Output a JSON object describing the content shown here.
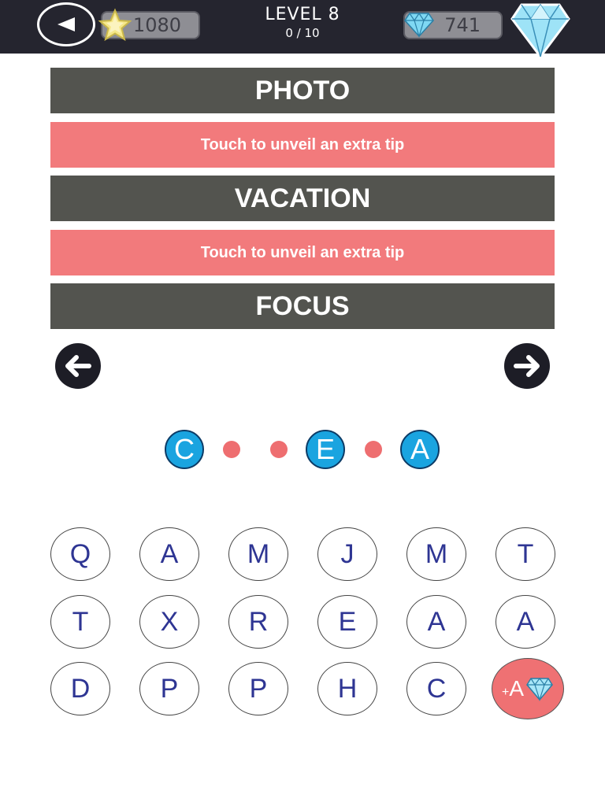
{
  "header": {
    "back_icon": "back-triangle-icon",
    "stars": "1080",
    "level_label": "LEVEL  8",
    "progress": "0 / 10",
    "gems": "741"
  },
  "clues": [
    {
      "type": "word",
      "text": "PHOTO"
    },
    {
      "type": "tip",
      "text": "Touch to unveil an extra tip"
    },
    {
      "type": "word",
      "text": "VACATION"
    },
    {
      "type": "tip",
      "text": "Touch to unveil an extra tip"
    },
    {
      "type": "word",
      "text": "FOCUS"
    }
  ],
  "answer": [
    "C",
    "",
    "",
    "E",
    "",
    "A"
  ],
  "keyboard": [
    [
      "Q",
      "A",
      "M",
      "J",
      "M",
      "T"
    ],
    [
      "T",
      "X",
      "R",
      "E",
      "A",
      "A"
    ],
    [
      "D",
      "P",
      "P",
      "H",
      "C"
    ]
  ],
  "hint_button": {
    "plus": "+",
    "letter": "A"
  },
  "colors": {
    "topbar": "#25252f",
    "word_bar": "#53544f",
    "tip_bar": "#f27a7c",
    "slot_filled": "#1aa4e0",
    "slot_empty": "#ee6e70",
    "key_text": "#2e3593"
  }
}
